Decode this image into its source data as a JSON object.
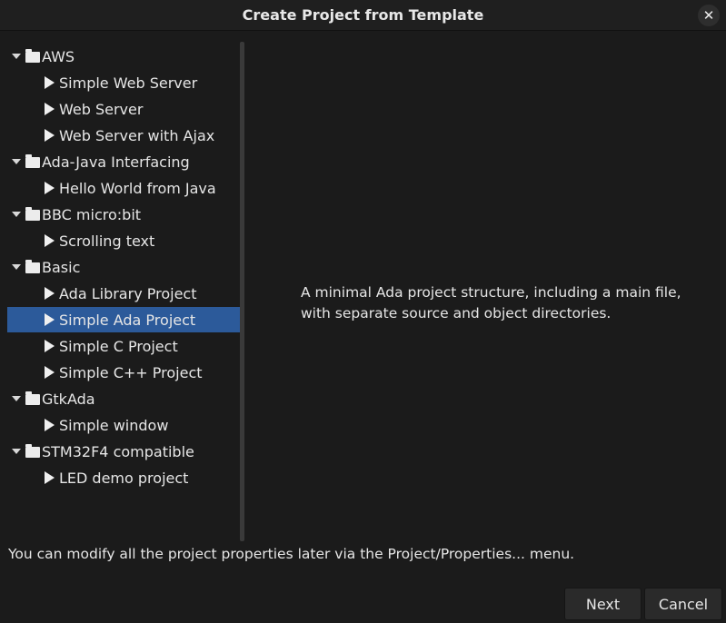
{
  "window": {
    "title": "Create Project from Template",
    "close_glyph": "✕"
  },
  "tree": {
    "rows": [
      {
        "label": "AWS",
        "kind": "category",
        "icon": "folder-icon",
        "expanded": true
      },
      {
        "label": "Simple Web Server",
        "kind": "template"
      },
      {
        "label": "Web Server",
        "kind": "template"
      },
      {
        "label": "Web Server with Ajax",
        "kind": "template"
      },
      {
        "label": "Ada-Java Interfacing",
        "kind": "category",
        "icon": "folder-icon",
        "expanded": true
      },
      {
        "label": "Hello World from Java",
        "kind": "template"
      },
      {
        "label": "BBC micro:bit",
        "kind": "category",
        "icon": "folder-icon",
        "expanded": true
      },
      {
        "label": "Scrolling text",
        "kind": "template"
      },
      {
        "label": "Basic",
        "kind": "category",
        "icon": "folder-icon",
        "expanded": true
      },
      {
        "label": "Ada Library Project",
        "kind": "template"
      },
      {
        "label": "Simple Ada Project",
        "kind": "template",
        "selected": true
      },
      {
        "label": "Simple C Project",
        "kind": "template"
      },
      {
        "label": "Simple C++ Project",
        "kind": "template"
      },
      {
        "label": "GtkAda",
        "kind": "category",
        "icon": "folder-icon",
        "expanded": true
      },
      {
        "label": "Simple window",
        "kind": "template"
      },
      {
        "label": "STM32F4 compatible",
        "kind": "category",
        "icon": "folder-icon",
        "expanded": true
      },
      {
        "label": "LED demo project",
        "kind": "template"
      }
    ]
  },
  "description": {
    "line1": "A minimal Ada project structure, including a main file,",
    "line2": "with separate source and object directories."
  },
  "hint": "You can modify all the project properties later via the Project/Properties... menu.",
  "buttons": {
    "next": "Next",
    "cancel": "Cancel"
  },
  "colors": {
    "background": "#1b1b1b",
    "selection": "#2c5a9a",
    "text": "#e6e6e6"
  }
}
